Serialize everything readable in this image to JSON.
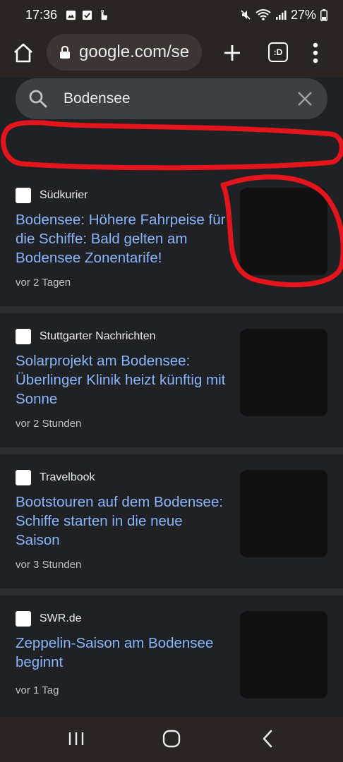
{
  "status_bar": {
    "time": "17:36",
    "battery": "27%",
    "icons": [
      "gallery-icon",
      "checkbox-icon",
      "hand-icon",
      "mute-icon",
      "wifi-icon",
      "signal-icon",
      "battery-icon"
    ]
  },
  "toolbar": {
    "url": "google.com/se",
    "tabs_label": ":D"
  },
  "search": {
    "query": "Bodensee"
  },
  "colors": {
    "background": "#202124",
    "link": "#8ab4f8",
    "annotation": "#e3141b"
  },
  "articles": [
    {
      "source": "Südkurier",
      "title": "Bodensee: Höhere Fahrpeise für die Schiffe: Bald gelten am Bodensee Zonentarife!",
      "time": "vor 2 Tagen"
    },
    {
      "source": "Stuttgarter Nachrichten",
      "title": "Solarprojekt am Bodensee: Überlinger Klinik heizt künftig mit Sonne",
      "time": "vor 2 Stunden"
    },
    {
      "source": "Travelbook",
      "title": "Bootstouren auf dem Bodensee: Schiffe starten in die neue Saison",
      "time": "vor 3 Stunden"
    },
    {
      "source": "SWR.de",
      "title": "Zeppelin-Saison am Bodensee beginnt",
      "time": "vor 1 Tag"
    }
  ]
}
